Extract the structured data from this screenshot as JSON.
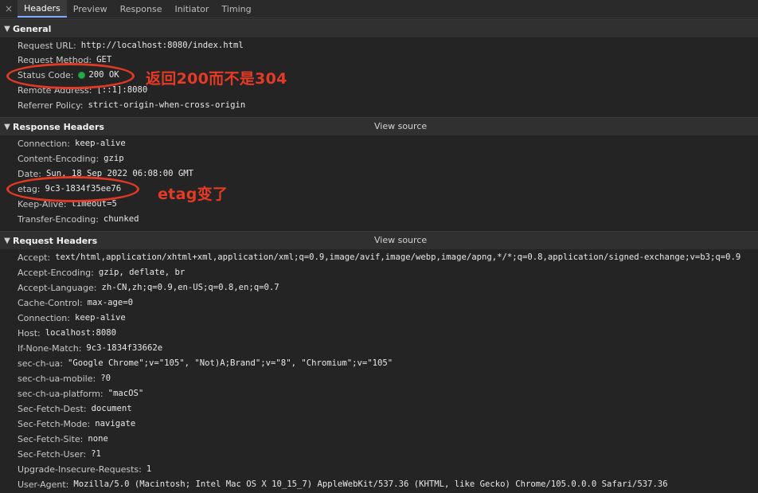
{
  "tabs": {
    "close_glyph": "×",
    "items": [
      "Headers",
      "Preview",
      "Response",
      "Initiator",
      "Timing"
    ],
    "active_index": 0
  },
  "general": {
    "title": "General",
    "rows": [
      {
        "key": "Request URL:",
        "value": "http://localhost:8080/index.html"
      },
      {
        "key": "Request Method:",
        "value": "GET"
      },
      {
        "key": "Status Code:",
        "value": "200  OK"
      },
      {
        "key": "Remote Address:",
        "value": "[::1]:8080"
      },
      {
        "key": "Referrer Policy:",
        "value": "strict-origin-when-cross-origin"
      }
    ]
  },
  "response_headers": {
    "title": "Response Headers",
    "view_source": "View source",
    "rows": [
      {
        "key": "Connection:",
        "value": "keep-alive"
      },
      {
        "key": "Content-Encoding:",
        "value": "gzip"
      },
      {
        "key": "Date:",
        "value": "Sun, 18 Sep 2022 06:08:00 GMT"
      },
      {
        "key": "etag:",
        "value": "9c3-1834f35ee76"
      },
      {
        "key": "Keep-Alive:",
        "value": "timeout=5"
      },
      {
        "key": "Transfer-Encoding:",
        "value": "chunked"
      }
    ]
  },
  "request_headers": {
    "title": "Request Headers",
    "view_source": "View source",
    "rows": [
      {
        "key": "Accept:",
        "value": "text/html,application/xhtml+xml,application/xml;q=0.9,image/avif,image/webp,image/apng,*/*;q=0.8,application/signed-exchange;v=b3;q=0.9"
      },
      {
        "key": "Accept-Encoding:",
        "value": "gzip, deflate, br"
      },
      {
        "key": "Accept-Language:",
        "value": "zh-CN,zh;q=0.9,en-US;q=0.8,en;q=0.7"
      },
      {
        "key": "Cache-Control:",
        "value": "max-age=0"
      },
      {
        "key": "Connection:",
        "value": "keep-alive"
      },
      {
        "key": "Host:",
        "value": "localhost:8080"
      },
      {
        "key": "If-None-Match:",
        "value": "9c3-1834f33662e"
      },
      {
        "key": "sec-ch-ua:",
        "value": "\"Google Chrome\";v=\"105\", \"Not)A;Brand\";v=\"8\", \"Chromium\";v=\"105\""
      },
      {
        "key": "sec-ch-ua-mobile:",
        "value": "?0"
      },
      {
        "key": "sec-ch-ua-platform:",
        "value": "\"macOS\""
      },
      {
        "key": "Sec-Fetch-Dest:",
        "value": "document"
      },
      {
        "key": "Sec-Fetch-Mode:",
        "value": "navigate"
      },
      {
        "key": "Sec-Fetch-Site:",
        "value": "none"
      },
      {
        "key": "Sec-Fetch-User:",
        "value": "?1"
      },
      {
        "key": "Upgrade-Insecure-Requests:",
        "value": "1"
      },
      {
        "key": "User-Agent:",
        "value": "Mozilla/5.0 (Macintosh; Intel Mac OS X 10_15_7) AppleWebKit/537.36 (KHTML, like Gecko) Chrome/105.0.0.0 Safari/537.36"
      }
    ]
  },
  "annotations": {
    "status_note": "返回200而不是304",
    "etag_note": "etag变了"
  },
  "colors": {
    "background": "#242424",
    "accent_annotation": "#e53a25",
    "status_ok": "#2aa84a"
  }
}
